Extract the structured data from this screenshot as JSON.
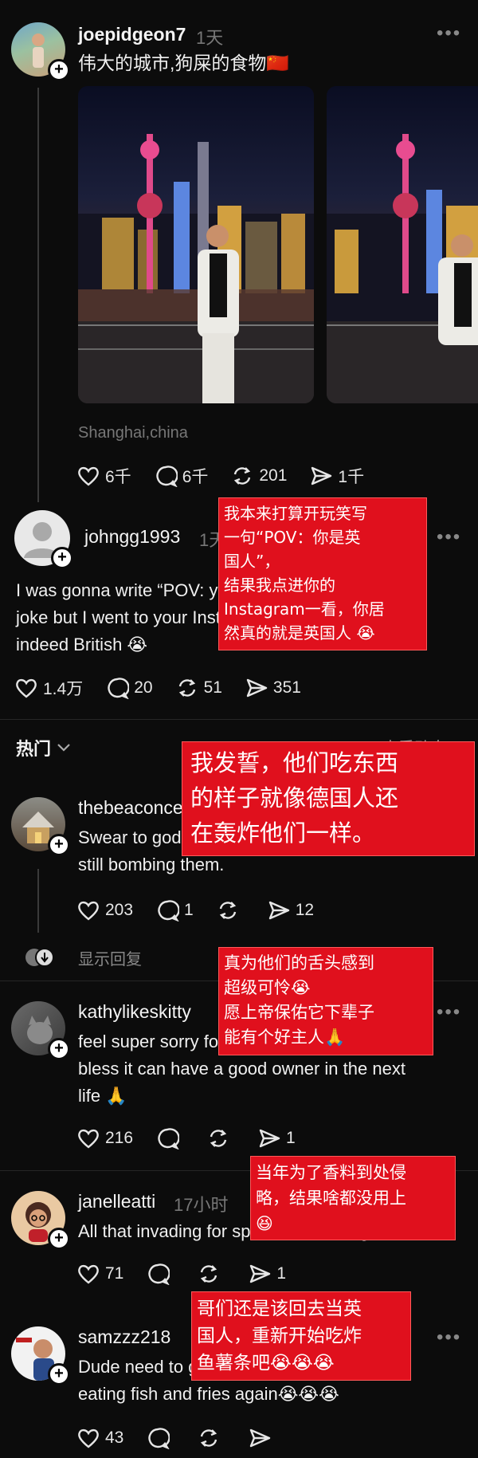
{
  "post": {
    "username": "joepidgeon7",
    "time": "1天",
    "text": "伟大的城市,狗屎的食物🇨🇳",
    "location": "Shanghai,china",
    "likes": "6千",
    "comments": "6千",
    "reposts": "201",
    "shares": "1千"
  },
  "reply1": {
    "username": "johngg1993",
    "time": "1天",
    "line1": "I was gonna write “POV: you're British” as a",
    "line2": "joke but I went to your Instagram and you're",
    "line3": "indeed British 😭",
    "likes": "1.4万",
    "comments": "20",
    "reposts": "51",
    "shares": "351"
  },
  "section": {
    "label": "热门",
    "right_label": "查看动态"
  },
  "comments": [
    {
      "username": "thebeaconce",
      "line1": "Swear to god they eat like the Germans are",
      "line2": "still bombing them.",
      "likes": "203",
      "comments": "1",
      "reposts": "",
      "shares": "12"
    },
    {
      "username": "kathylikeskitty",
      "line1": "feel super sorry for their tongue. may god",
      "line2": "bless it can have a good owner in the next",
      "line3": "life 🙏",
      "likes": "216",
      "shares": "1"
    },
    {
      "username": "janelleatti",
      "time": "17小时",
      "line1": "All that invading for spices for nothing 😆",
      "likes": "71",
      "shares": "1"
    },
    {
      "username": "samzzz218",
      "line1": "Dude need to go back to being british and",
      "line2": "eating fish and fries again😭😭😭",
      "likes": "43"
    }
  ],
  "show_replies": "显示回复",
  "translations": {
    "t1": [
      "我本来打算开玩笑写",
      "一句“POV：你是英",
      "国人”，",
      "结果我点进你的",
      "Instagram一看，你居",
      "然真的就是英国人 😭"
    ],
    "t2": [
      "我发誓，他们吃东西",
      "的样子就像德国人还",
      "在轰炸他们一样。"
    ],
    "t3": [
      "真为他们的舌头感到",
      "超级可怜😭",
      "愿上帝保佑它下辈子",
      "能有个好主人🙏"
    ],
    "t4": [
      "当年为了香料到处侵",
      "略，结果啥都没用上",
      "😆"
    ],
    "t5": [
      "哥们还是该回去当英",
      "国人，重新开始吃炸",
      "鱼薯条吧😭😭😭"
    ]
  },
  "colors": {
    "background": "#0c0c0c",
    "translation_box": "#e0101d"
  }
}
